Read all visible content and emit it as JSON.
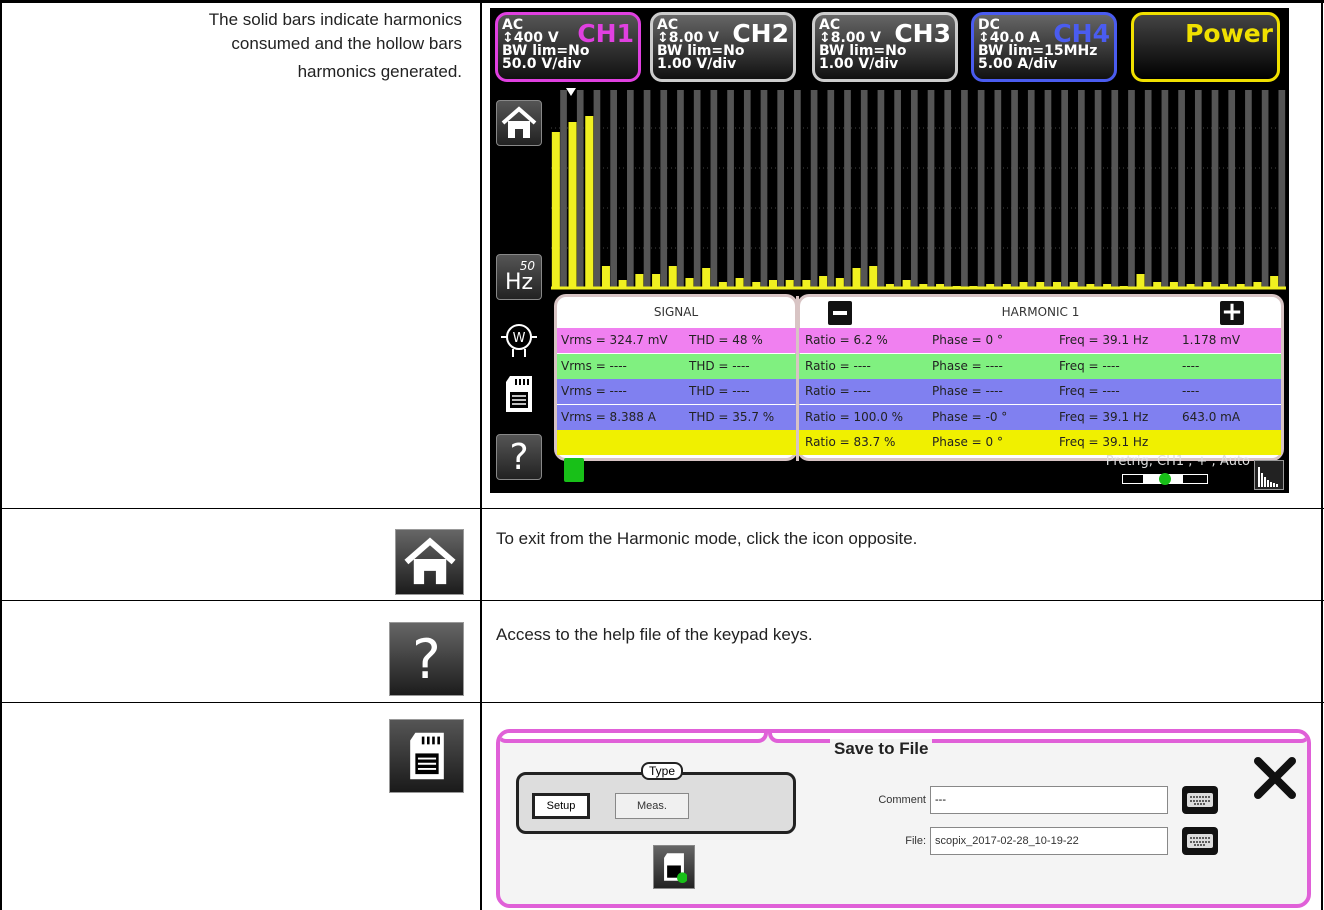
{
  "doc": {
    "row1_text_lines": [
      "The solid bars indicate harmonics",
      "consumed and the hollow bars",
      "harmonics generated."
    ],
    "row2_text": "To exit from the Harmonic mode, click the icon opposite.",
    "row3_text": "Access to the help file of the keypad keys."
  },
  "channels": [
    {
      "coupling": "AC",
      "range": "↕400 V",
      "bw": "BW lim=No",
      "scale": "50.0 V/div",
      "name": "CH1",
      "color": "#e040e0"
    },
    {
      "coupling": "AC",
      "range": "↕8.00 V",
      "bw": "BW lim=No",
      "scale": "1.00 V/div",
      "name": "CH2",
      "color": "#cccccc"
    },
    {
      "coupling": "AC",
      "range": "↕8.00 V",
      "bw": "BW lim=No",
      "scale": "1.00 V/div",
      "name": "CH3",
      "color": "#cccccc"
    },
    {
      "coupling": "DC",
      "range": "↕40.0 A",
      "bw": "BW lim=15MHz",
      "scale": "5.00 A/div",
      "name": "CH4",
      "color": "#4a5cf0"
    }
  ],
  "power_label": "Power",
  "freq_button": {
    "value": "50",
    "unit": "Hz"
  },
  "signal_header": "SIGNAL",
  "harmonic_header": "HARMONIC 1",
  "rows": [
    {
      "color": "#f080f0",
      "vrms": "Vrms = 324.7 mV",
      "thd": "THD = 48 %",
      "ratio": "Ratio = 6.2 %",
      "phase": "Phase = 0 °",
      "freq": "Freq = 39.1 Hz",
      "val": "1.178 mV"
    },
    {
      "color": "#80f080",
      "vrms": "Vrms = ----",
      "thd": "THD = ----",
      "ratio": "Ratio = ----",
      "phase": "Phase = ----",
      "freq": "Freq = ----",
      "val": "----"
    },
    {
      "color": "#8080f0",
      "vrms": "Vrms = ----",
      "thd": "THD = ----",
      "ratio": "Ratio = ----",
      "phase": "Phase = ----",
      "freq": "Freq = ----",
      "val": "----"
    },
    {
      "color": "#8080f0",
      "vrms": "Vrms = 8.388 A",
      "thd": "THD = 35.7 %",
      "ratio": "Ratio = 100.0 %",
      "phase": "Phase = -0 °",
      "freq": "Freq = 39.1 Hz",
      "val": "643.0 mA"
    },
    {
      "color": "#f0f000",
      "vrms": "",
      "thd": "",
      "ratio": "Ratio = 83.7 %",
      "phase": "Phase = 0 °",
      "freq": "Freq = 39.1 Hz",
      "val": ""
    }
  ],
  "trigger_status": "Pretrig, CH1 , + , Auto",
  "harmonic_bars": {
    "solid": [
      0.78,
      0.83,
      0.86,
      0.11,
      0.04,
      0.07,
      0.07,
      0.11,
      0.05,
      0.1,
      0.03,
      0.05,
      0.03,
      0.04,
      0.04,
      0.04,
      0.06,
      0.05,
      0.1,
      0.11,
      0.02,
      0.04,
      0.02,
      0.02,
      0.01,
      0.01,
      0.02,
      0.02,
      0.03,
      0.03,
      0.03,
      0.03,
      0.02,
      0.02,
      0.01,
      0.07,
      0.03,
      0.03,
      0.02,
      0.03,
      0.02,
      0.02,
      0.03,
      0.06
    ],
    "hollow": [
      1.0
    ]
  },
  "save_dialog": {
    "title": "Save to File",
    "type_label": "Type",
    "setup_label": "Setup",
    "meas_label": "Meas.",
    "comment_label": "Comment",
    "comment_value": "---",
    "file_label": "File:",
    "file_value": "scopix_2017-02-28_10-19-22"
  }
}
